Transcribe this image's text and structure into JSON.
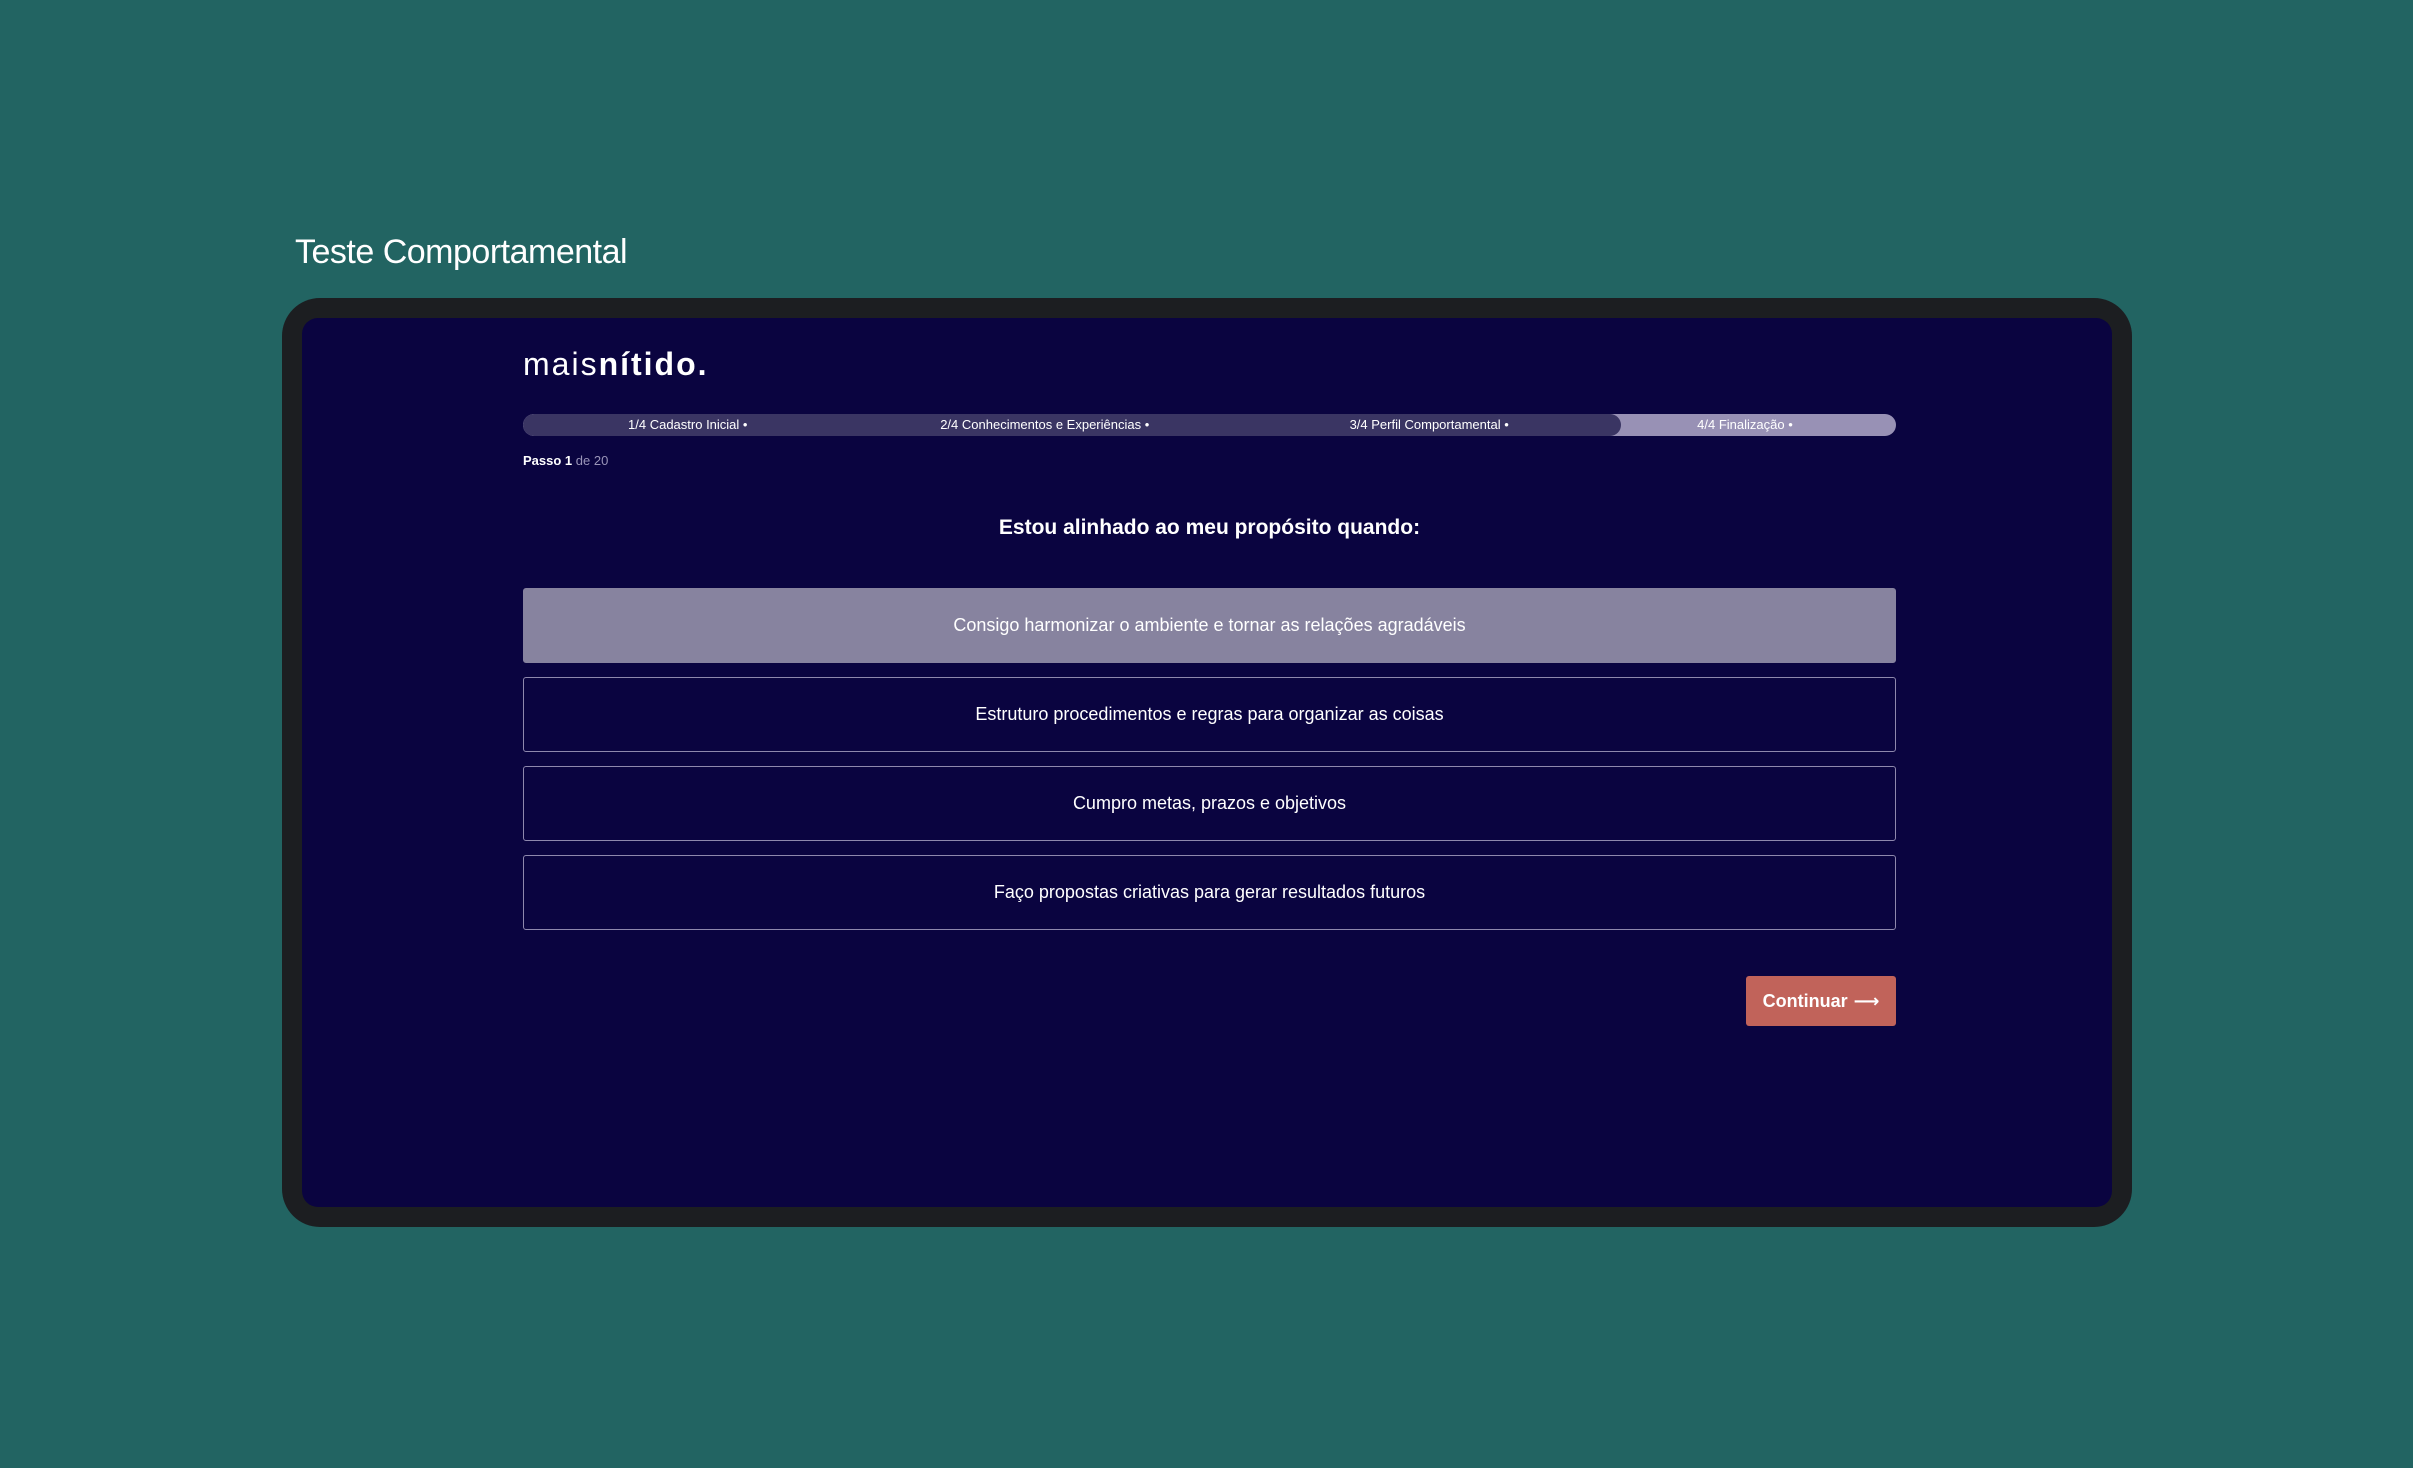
{
  "page": {
    "title": "Teste Comportamental"
  },
  "logo": {
    "light": "mais",
    "bold": "nítido."
  },
  "progress": {
    "fraction_completed": 0.8,
    "steps": [
      {
        "label": "1/4 Cadastro Inicial •"
      },
      {
        "label": "2/4 Conhecimentos e Experiências •"
      },
      {
        "label": "3/4 Perfil Comportamental •"
      },
      {
        "label": "4/4 Finalização •"
      }
    ]
  },
  "step_counter": {
    "current": "Passo 1",
    "total": "de 20"
  },
  "question": {
    "text": "Estou alinhado ao meu propósito quando:"
  },
  "options": [
    {
      "label": "Consigo harmonizar o ambiente e tornar as relações agradáveis",
      "selected": true
    },
    {
      "label": "Estruturo procedimentos e regras para organizar as coisas",
      "selected": false
    },
    {
      "label": "Cumpro metas, prazos e objetivos",
      "selected": false
    },
    {
      "label": "Faço propostas criativas para gerar resultados futuros",
      "selected": false
    }
  ],
  "actions": {
    "continue_label": "Continuar",
    "continue_icon": "arrow-right-icon",
    "continue_color": "#c1635a"
  },
  "colors": {
    "background": "#226462",
    "screen": "#0a0440",
    "selected_option": "#87839f"
  }
}
